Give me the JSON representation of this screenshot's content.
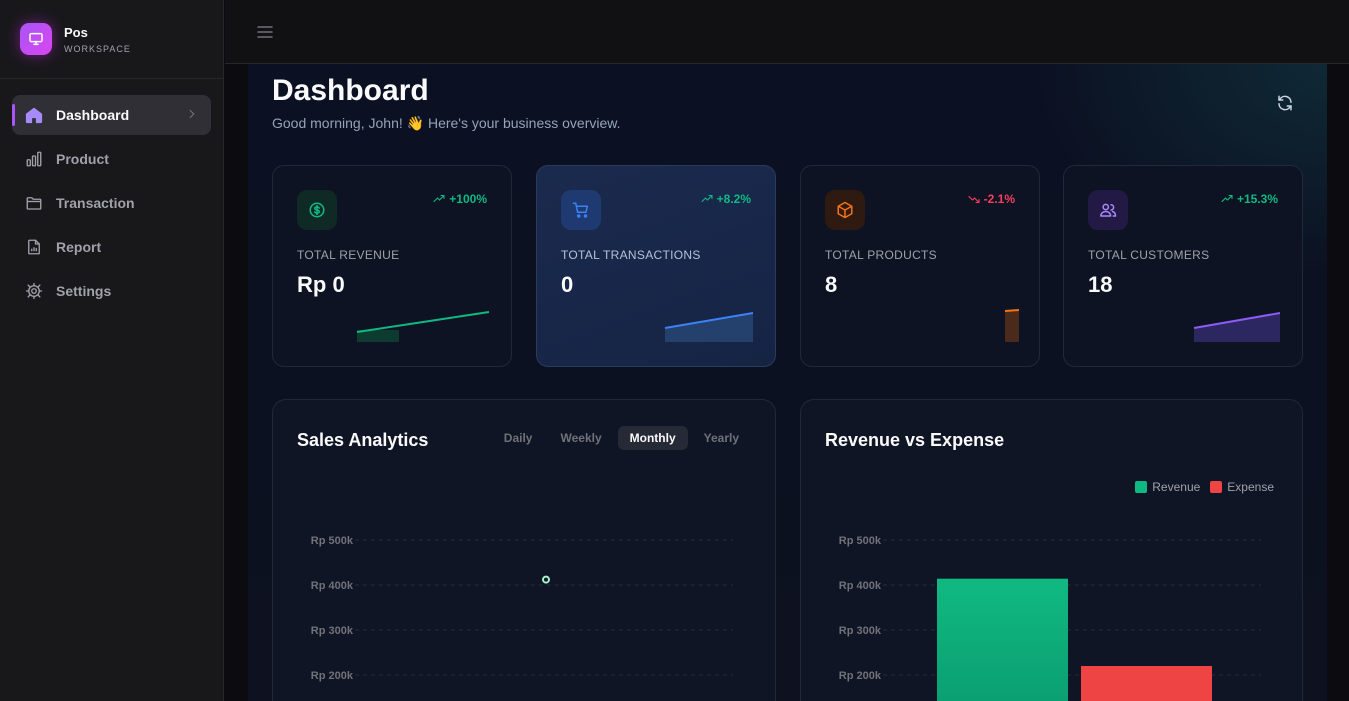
{
  "brand": {
    "name": "Pos",
    "subtitle": "WORKSPACE",
    "icon": "monitor-icon"
  },
  "sidebar": {
    "items": [
      {
        "label": "Dashboard",
        "icon": "home-icon",
        "active": true
      },
      {
        "label": "Product",
        "icon": "bar-chart-icon"
      },
      {
        "label": "Transaction",
        "icon": "folder-icon"
      },
      {
        "label": "Report",
        "icon": "file-chart-icon"
      },
      {
        "label": "Settings",
        "icon": "gear-icon"
      }
    ]
  },
  "topbar": {
    "menu_icon": "menu-icon"
  },
  "page": {
    "title": "Dashboard",
    "subtitle": "Good morning, John! 👋 Here's your business overview."
  },
  "stats": [
    {
      "label": "TOTAL REVENUE",
      "value": "Rp 0",
      "trend": "+100%",
      "direction": "up",
      "icon": "dollar-icon",
      "accent": "#10b981"
    },
    {
      "label": "TOTAL TRANSACTIONS",
      "value": "0",
      "trend": "+8.2%",
      "direction": "up",
      "icon": "cart-icon",
      "accent": "#3b82f6"
    },
    {
      "label": "TOTAL PRODUCTS",
      "value": "8",
      "trend": "-2.1%",
      "direction": "down",
      "icon": "box-icon",
      "accent": "#f97316"
    },
    {
      "label": "TOTAL CUSTOMERS",
      "value": "18",
      "trend": "+15.3%",
      "direction": "up",
      "icon": "users-icon",
      "accent": "#8b5cf6"
    }
  ],
  "colors": {
    "up": "#10b981",
    "down": "#f43f5e"
  },
  "sales": {
    "title": "Sales Analytics",
    "tabs": [
      "Daily",
      "Weekly",
      "Monthly",
      "Yearly"
    ],
    "active_tab": "Monthly"
  },
  "revexp": {
    "title": "Revenue vs Expense",
    "legend": [
      {
        "name": "Revenue",
        "color": "#10b981"
      },
      {
        "name": "Expense",
        "color": "#ef4444"
      }
    ]
  },
  "chart_data": [
    {
      "type": "line",
      "title": "Sales Analytics",
      "y_ticks": [
        "Rp 500k",
        "Rp 400k",
        "Rp 300k",
        "Rp 200k"
      ],
      "ylim": [
        200000,
        500000
      ],
      "series": [
        {
          "values": [
            412000
          ]
        }
      ],
      "grid": true
    },
    {
      "type": "bar",
      "title": "Revenue vs Expense",
      "y_ticks": [
        "Rp 500k",
        "Rp 400k",
        "Rp 300k",
        "Rp 200k"
      ],
      "ylim": [
        200000,
        500000
      ],
      "series": [
        {
          "name": "Revenue",
          "values": [
            414000
          ]
        },
        {
          "name": "Expense",
          "values": [
            220000
          ]
        }
      ],
      "grid": true,
      "legend": "top-right"
    }
  ]
}
